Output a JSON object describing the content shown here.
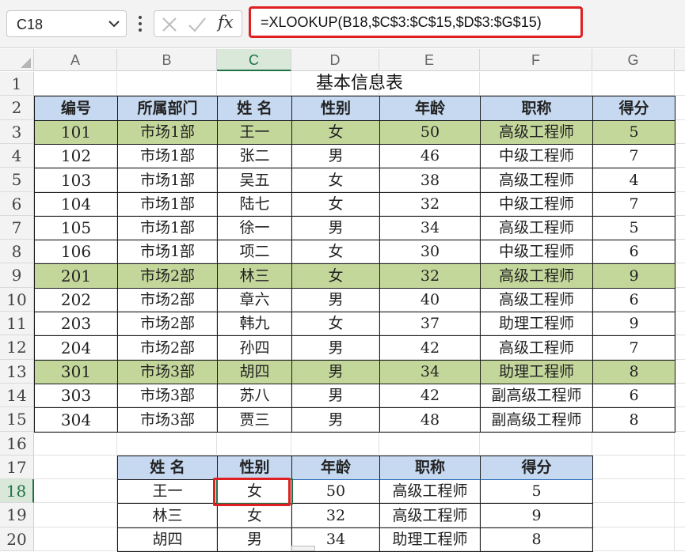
{
  "formula_bar": {
    "name_box": "C18",
    "fx_label": "fx",
    "formula": "=XLOOKUP(B18,$C$3:$C$15,$D$3:$G$15)"
  },
  "columns": [
    "A",
    "B",
    "C",
    "D",
    "E",
    "F",
    "G"
  ],
  "rows": [
    "1",
    "2",
    "3",
    "4",
    "5",
    "6",
    "7",
    "8",
    "9",
    "10",
    "11",
    "12",
    "13",
    "14",
    "15",
    "16",
    "17",
    "18",
    "19",
    "20"
  ],
  "main_table": {
    "title": "基本信息表",
    "headers": [
      "编号",
      "所属部门",
      "姓 名",
      "性别",
      "年龄",
      "职称",
      "得分"
    ],
    "rows": [
      {
        "cells": [
          "101",
          "市场1部",
          "王一",
          "女",
          "50",
          "高级工程师",
          "5"
        ],
        "highlight": true
      },
      {
        "cells": [
          "102",
          "市场1部",
          "张二",
          "男",
          "46",
          "中级工程师",
          "7"
        ],
        "highlight": false
      },
      {
        "cells": [
          "103",
          "市场1部",
          "吴五",
          "女",
          "38",
          "高级工程师",
          "4"
        ],
        "highlight": false
      },
      {
        "cells": [
          "104",
          "市场1部",
          "陆七",
          "女",
          "32",
          "中级工程师",
          "7"
        ],
        "highlight": false
      },
      {
        "cells": [
          "105",
          "市场1部",
          "徐一",
          "男",
          "34",
          "高级工程师",
          "5"
        ],
        "highlight": false
      },
      {
        "cells": [
          "106",
          "市场1部",
          "项二",
          "女",
          "30",
          "中级工程师",
          "6"
        ],
        "highlight": false
      },
      {
        "cells": [
          "201",
          "市场2部",
          "林三",
          "女",
          "32",
          "高级工程师",
          "9"
        ],
        "highlight": true
      },
      {
        "cells": [
          "202",
          "市场2部",
          "章六",
          "男",
          "40",
          "高级工程师",
          "6"
        ],
        "highlight": false
      },
      {
        "cells": [
          "203",
          "市场2部",
          "韩九",
          "女",
          "37",
          "助理工程师",
          "9"
        ],
        "highlight": false
      },
      {
        "cells": [
          "204",
          "市场2部",
          "孙四",
          "男",
          "42",
          "高级工程师",
          "7"
        ],
        "highlight": false
      },
      {
        "cells": [
          "301",
          "市场3部",
          "胡四",
          "男",
          "34",
          "助理工程师",
          "8"
        ],
        "highlight": true
      },
      {
        "cells": [
          "303",
          "市场3部",
          "苏八",
          "男",
          "42",
          "副高级工程师",
          "6"
        ],
        "highlight": false
      },
      {
        "cells": [
          "304",
          "市场3部",
          "贾三",
          "男",
          "48",
          "副高级工程师",
          "8"
        ],
        "highlight": false
      }
    ]
  },
  "lookup_table": {
    "headers": [
      "姓 名",
      "性别",
      "年龄",
      "职称",
      "得分"
    ],
    "rows": [
      [
        "王一",
        "女",
        "50",
        "高级工程师",
        "5"
      ],
      [
        "林三",
        "女",
        "32",
        "高级工程师",
        "9"
      ],
      [
        "胡四",
        "男",
        "34",
        "助理工程师",
        "8"
      ]
    ]
  },
  "colors": {
    "header_fill": "#c6d9f0",
    "highlight_fill": "#c4d79b",
    "annotation_red": "#e02020",
    "selection_green": "#217346"
  }
}
